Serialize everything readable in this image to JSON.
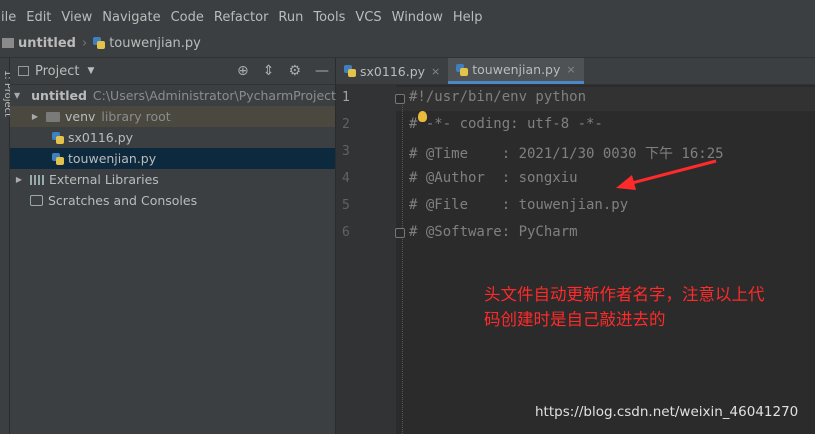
{
  "menu": [
    "ile",
    "Edit",
    "View",
    "Navigate",
    "Code",
    "Refactor",
    "Run",
    "Tools",
    "VCS",
    "Window",
    "Help"
  ],
  "navbar": {
    "project": "untitled",
    "file": "touwenjian.py"
  },
  "side_strip_label": "1: Project",
  "project_panel": {
    "title": "Project",
    "tree": [
      {
        "label": "untitled",
        "extra": "C:\\Users\\Administrator\\PycharmProjects"
      },
      {
        "label": "venv",
        "extra": "library root"
      },
      {
        "label": "sx0116.py"
      },
      {
        "label": "touwenjian.py"
      },
      {
        "label": "External Libraries"
      },
      {
        "label": "Scratches and Consoles"
      }
    ]
  },
  "tabs": [
    {
      "label": "sx0116.py",
      "close": "×"
    },
    {
      "label": "touwenjian.py",
      "close": "×"
    }
  ],
  "editor": {
    "line_numbers": [
      "1",
      "2",
      "3",
      "4",
      "5",
      "6"
    ],
    "lines": [
      "#!/usr/bin/env python",
      "# -*- coding: utf-8 -*-",
      "# @Time    : 2021/1/30 0030 下午 16:25",
      "# @Author  : songxiu",
      "# @File    : touwenjian.py",
      "# @Software: PyCharm"
    ]
  },
  "annotation": {
    "line1": "头文件自动更新作者名字，注意以上代",
    "line2": "码创建时是自己敲进去的",
    "color": "#ff2a2a"
  },
  "watermark": "https://blog.csdn.net/weixin_46041270",
  "colors": {
    "editor_bg": "#2b2b2b",
    "panel_bg": "#3c3f41",
    "selection": "#0d293e",
    "tab_underline": "#4a88c7"
  }
}
